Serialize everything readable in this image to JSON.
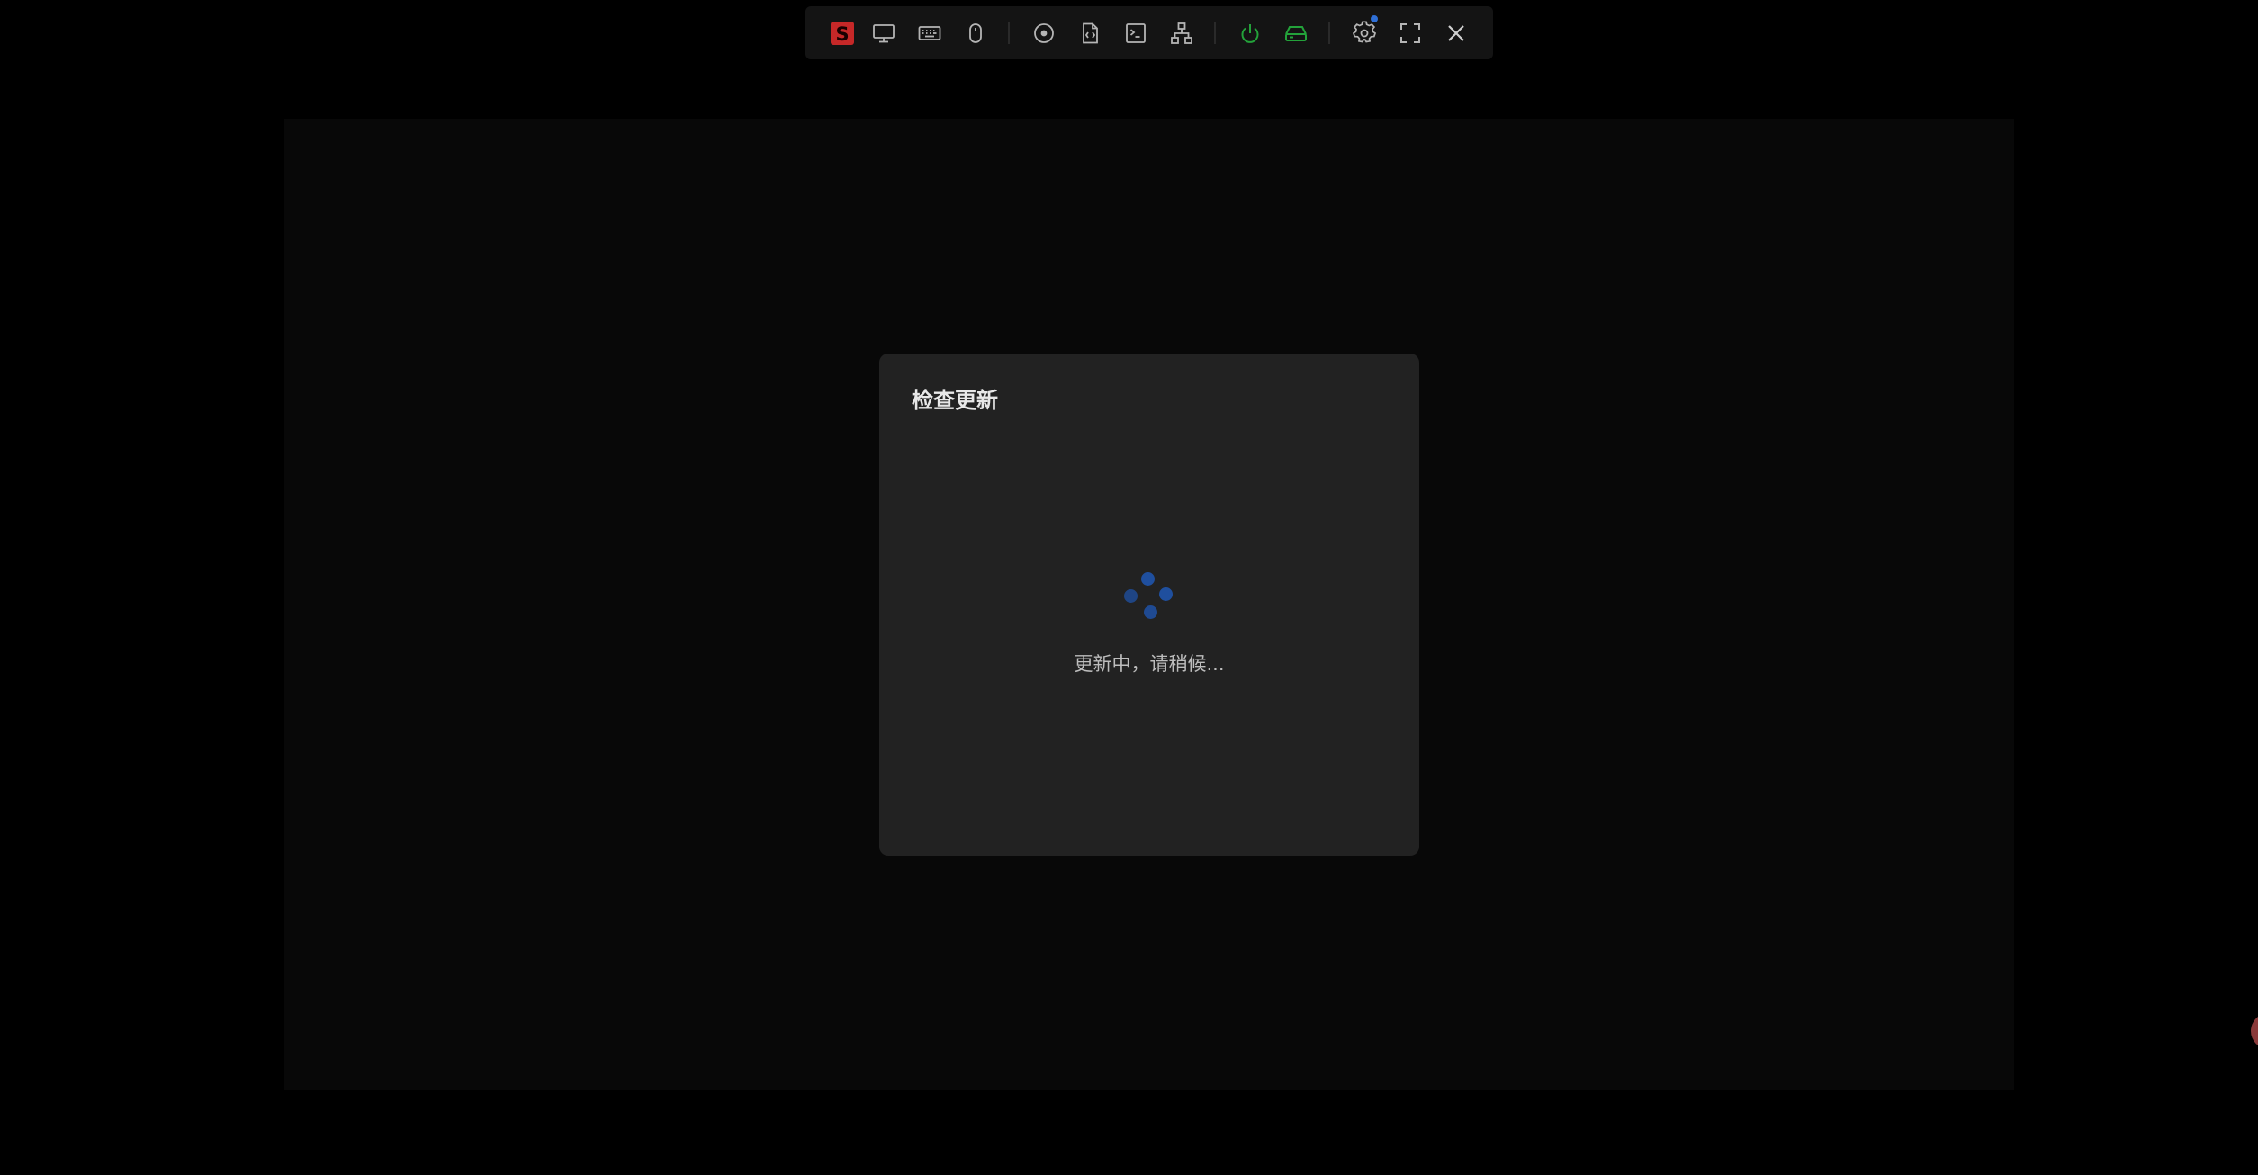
{
  "colors": {
    "background": "#000000",
    "screen": "#080808",
    "toolbar": "#141414",
    "dialog": "#222222",
    "icon": "#b5b5b5",
    "brand": "#c62828",
    "power_green": "#23a23a",
    "accent_blue": "#2f6fd6",
    "spinner": "#1f4f9e"
  },
  "toolbar": {
    "items": [
      {
        "icon": "brand-logo-icon",
        "label": "S"
      },
      {
        "icon": "monitor-icon"
      },
      {
        "icon": "keyboard-icon"
      },
      {
        "icon": "mouse-icon"
      },
      {
        "icon": "disc-icon"
      },
      {
        "icon": "script-file-icon"
      },
      {
        "icon": "terminal-icon"
      },
      {
        "icon": "network-icon"
      },
      {
        "icon": "power-icon"
      },
      {
        "icon": "drive-icon"
      },
      {
        "icon": "settings-icon",
        "has_notification": true
      },
      {
        "icon": "fullscreen-icon"
      },
      {
        "icon": "close-icon"
      }
    ]
  },
  "dialog": {
    "title": "检查更新",
    "status": "更新中，请稍候..."
  }
}
